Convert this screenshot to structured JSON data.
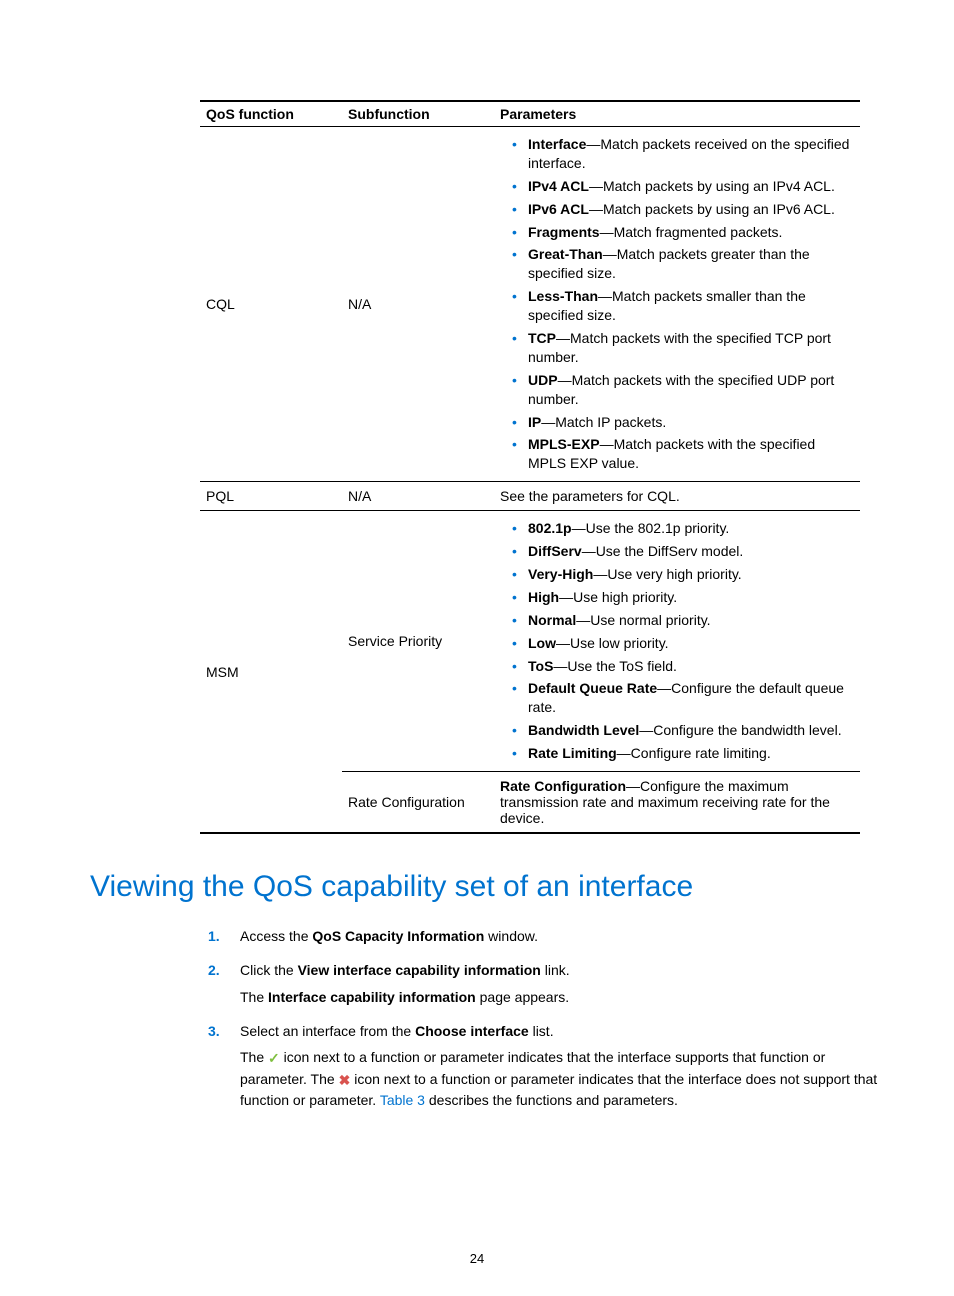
{
  "table": {
    "headers": [
      "QoS function",
      "Subfunction",
      "Parameters"
    ],
    "rows": [
      {
        "func": "CQL",
        "sub": "N/A",
        "params": [
          {
            "k": "Interface",
            "d": "—Match packets received on the specified interface."
          },
          {
            "k": "IPv4 ACL",
            "d": "—Match packets by using an IPv4 ACL."
          },
          {
            "k": "IPv6 ACL",
            "d": "—Match packets by using an IPv6 ACL."
          },
          {
            "k": "Fragments",
            "d": "—Match fragmented packets."
          },
          {
            "k": "Great-Than",
            "d": "—Match packets greater than the specified size."
          },
          {
            "k": "Less-Than",
            "d": "—Match packets smaller than the specified size."
          },
          {
            "k": "TCP",
            "d": "—Match packets with the specified TCP port number."
          },
          {
            "k": "UDP",
            "d": "—Match packets with the specified UDP port number."
          },
          {
            "k": "IP",
            "d": "—Match IP packets."
          },
          {
            "k": "MPLS-EXP",
            "d": "—Match packets with the specified MPLS EXP value."
          }
        ]
      },
      {
        "func": "PQL",
        "sub": "N/A",
        "plain": "See the parameters for CQL."
      },
      {
        "func": "MSM",
        "sub": "Service Priority",
        "params": [
          {
            "k": "802.1p",
            "d": "—Use the 802.1p priority."
          },
          {
            "k": "DiffServ",
            "d": "—Use the DiffServ model."
          },
          {
            "k": "Very-High",
            "d": "—Use very high priority."
          },
          {
            "k": "High",
            "d": "—Use high priority."
          },
          {
            "k": "Normal",
            "d": "—Use normal priority."
          },
          {
            "k": "Low",
            "d": "—Use low priority."
          },
          {
            "k": "ToS",
            "d": "—Use the ToS field."
          },
          {
            "k": "Default Queue Rate",
            "d": "—Configure the default queue rate."
          },
          {
            "k": "Bandwidth Level",
            "d": "—Configure the bandwidth level."
          },
          {
            "k": "Rate Limiting",
            "d": "—Configure rate limiting."
          }
        ]
      },
      {
        "func": "",
        "sub": "Rate Configuration",
        "kv": {
          "k": "Rate Configuration",
          "d": "—Configure the maximum transmission rate and maximum receiving rate for the device."
        }
      }
    ]
  },
  "section_heading": "Viewing the QoS capability set of an interface",
  "steps": {
    "s1a": "Access the ",
    "s1b": "QoS Capacity Information",
    "s1c": " window.",
    "s2a": "Click the ",
    "s2b": "View interface capability information",
    "s2c": " link.",
    "s2d": "The ",
    "s2e": "Interface capability information",
    "s2f": " page appears.",
    "s3a": "Select an interface from the ",
    "s3b": "Choose interface",
    "s3c": " list.",
    "s3d1": "The ",
    "s3d2": " icon next to a function or parameter indicates that the interface supports that function or parameter. The ",
    "s3d3": " icon next to a function or parameter indicates that the interface does not support that function or parameter. ",
    "s3link": "Table 3",
    "s3d4": " describes the functions and parameters."
  },
  "page_number": "24",
  "glyphs": {
    "check": "✓",
    "cross": "✖"
  }
}
